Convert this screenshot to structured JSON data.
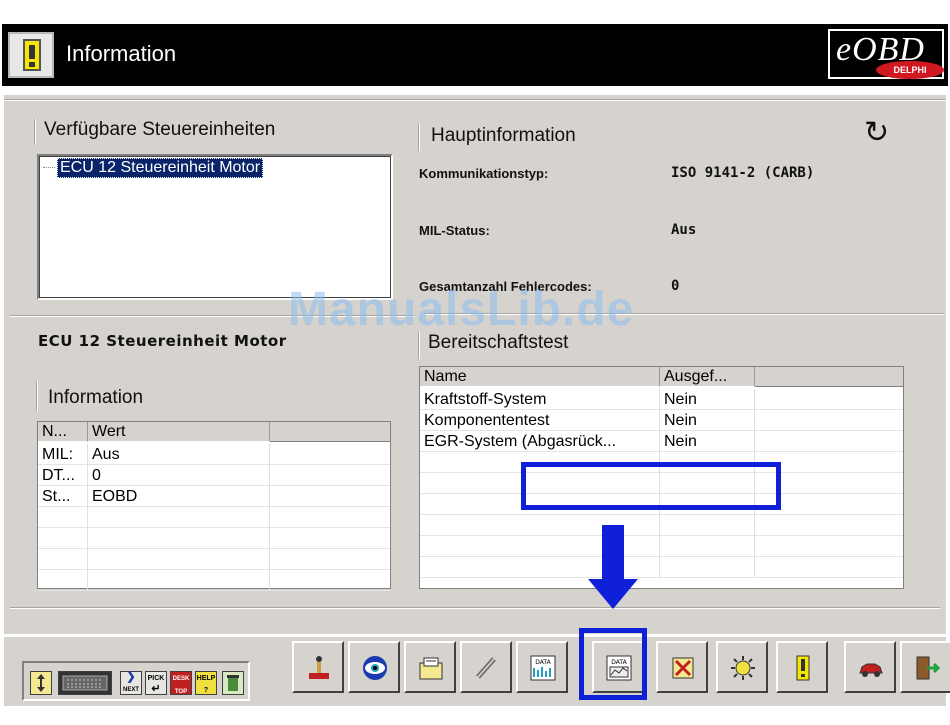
{
  "window": {
    "title": "Information",
    "logo_text": "eOBD",
    "logo_badge": "DELPHI"
  },
  "left_panel": {
    "group_title": "Verfügbare Steuereinheiten",
    "list_items": [
      "ECU 12 Steuereinheit Motor"
    ],
    "selected_ecu_label": "ECU 12 Steuereinheit Motor"
  },
  "info_group": {
    "title": "Information",
    "columns": [
      "N...",
      "Wert"
    ],
    "rows": [
      [
        "MIL:",
        "Aus"
      ],
      [
        "DT...",
        "0"
      ],
      [
        "St...",
        "EOBD"
      ]
    ]
  },
  "main_info": {
    "title": "Hauptinformation",
    "fields": [
      {
        "label": "Kommunikationstyp:",
        "value": "ISO 9141-2 (CARB)"
      },
      {
        "label": "MIL-Status:",
        "value": "Aus"
      },
      {
        "label": "Gesamtanzahl Fehlercodes:",
        "value": "0"
      }
    ]
  },
  "readiness": {
    "title": "Bereitschaftstest",
    "columns": [
      "Name",
      "Ausgef..."
    ],
    "rows": [
      [
        "Kraftstoff-System",
        "Nein"
      ],
      [
        "Komponententest",
        "Nein"
      ],
      [
        "EGR-System (Abgasrück...",
        "Nein"
      ]
    ]
  },
  "watermark": "ManualsLib.de",
  "toolbar": {
    "mini_buttons": [
      {
        "icon": "move-icon",
        "label": ""
      },
      {
        "icon": "keyboard-icon",
        "label": ""
      },
      {
        "icon": "next-icon",
        "label": "NEXT"
      },
      {
        "icon": "pick-icon",
        "label": "PICK"
      },
      {
        "icon": "desktop-icon",
        "label": "DESK TOP"
      },
      {
        "icon": "help-icon",
        "label": "HELP ?"
      },
      {
        "icon": "trash-icon",
        "label": ""
      }
    ],
    "buttons": [
      {
        "icon": "joystick-icon",
        "label": ""
      },
      {
        "icon": "eye-icon",
        "label": ""
      },
      {
        "icon": "folder-icon",
        "label": ""
      },
      {
        "icon": "sensor-icon",
        "label": ""
      },
      {
        "icon": "data-live-icon",
        "label": "DATA"
      },
      {
        "icon": "data-graph-icon",
        "label": "DATA"
      },
      {
        "icon": "clear-codes-icon",
        "label": ""
      },
      {
        "icon": "sun-icon",
        "label": ""
      },
      {
        "icon": "warning-icon",
        "label": ""
      },
      {
        "icon": "car-icon",
        "label": ""
      },
      {
        "icon": "exit-icon",
        "label": ""
      }
    ]
  },
  "colors": {
    "title_bar": "#000000",
    "panel_bg": "#d6d3ce",
    "selection": "#0a246a",
    "annotation": "#1020d8",
    "watermark": "#8cbef0"
  }
}
